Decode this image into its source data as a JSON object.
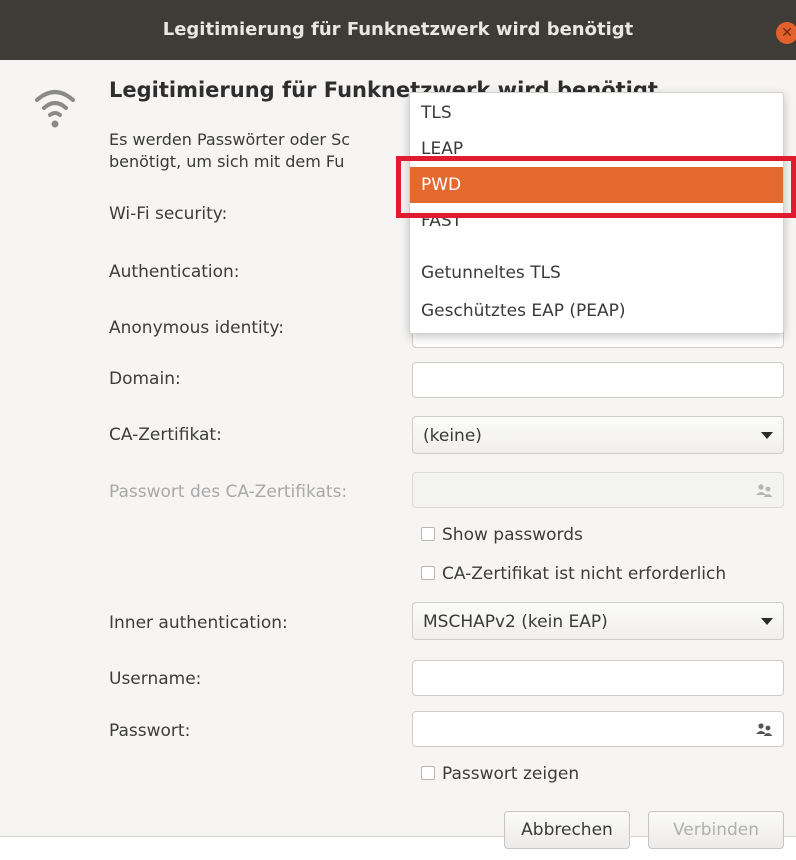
{
  "window": {
    "title": "Legitimierung für Funknetzwerk wird benötigt"
  },
  "header": {
    "heading": "Legitimierung für Funknetzwerk wird benötigt",
    "desc_line1": "Es werden Passwörter oder Sc",
    "desc_line2": "benötigt, um sich mit dem Fu"
  },
  "form": {
    "wifi_security_label": "Wi-Fi security:",
    "authentication_label": "Authentication:",
    "anonymous_identity_label": "Anonymous identity:",
    "anonymous_identity_value": "",
    "domain_label": "Domain:",
    "domain_value": "",
    "ca_cert_label": "CA-Zertifikat:",
    "ca_cert_value": "(keine)",
    "ca_cert_password_label": "Passwort des CA-Zertifikats:",
    "ca_cert_password_value": "",
    "show_passwords_label": "Show passwords",
    "ca_not_required_label": "CA-Zertifikat ist nicht erforderlich",
    "inner_auth_label": "Inner authentication:",
    "inner_auth_value": "MSCHAPv2 (kein EAP)",
    "username_label": "Username:",
    "username_value": "",
    "password_label": "Passwort:",
    "password_value": "",
    "show_password_label": "Passwort zeigen"
  },
  "buttons": {
    "cancel": "Abbrechen",
    "connect": "Verbinden"
  },
  "authentication_dropdown": {
    "options": [
      "TLS",
      "LEAP",
      "PWD",
      "FAST",
      "Getunneltes TLS",
      "Geschütztes EAP (PEAP)"
    ],
    "selected": "PWD"
  },
  "icons": {
    "wifi": "wifi-icon",
    "close": "close-icon",
    "users": "users-icon",
    "dropdown_arrow": "chevron-down-icon"
  },
  "colors": {
    "accent": "#e3692f",
    "highlight_box": "#e11b2f",
    "titlebar": "#3f3c38",
    "close_button": "#e5612c"
  }
}
